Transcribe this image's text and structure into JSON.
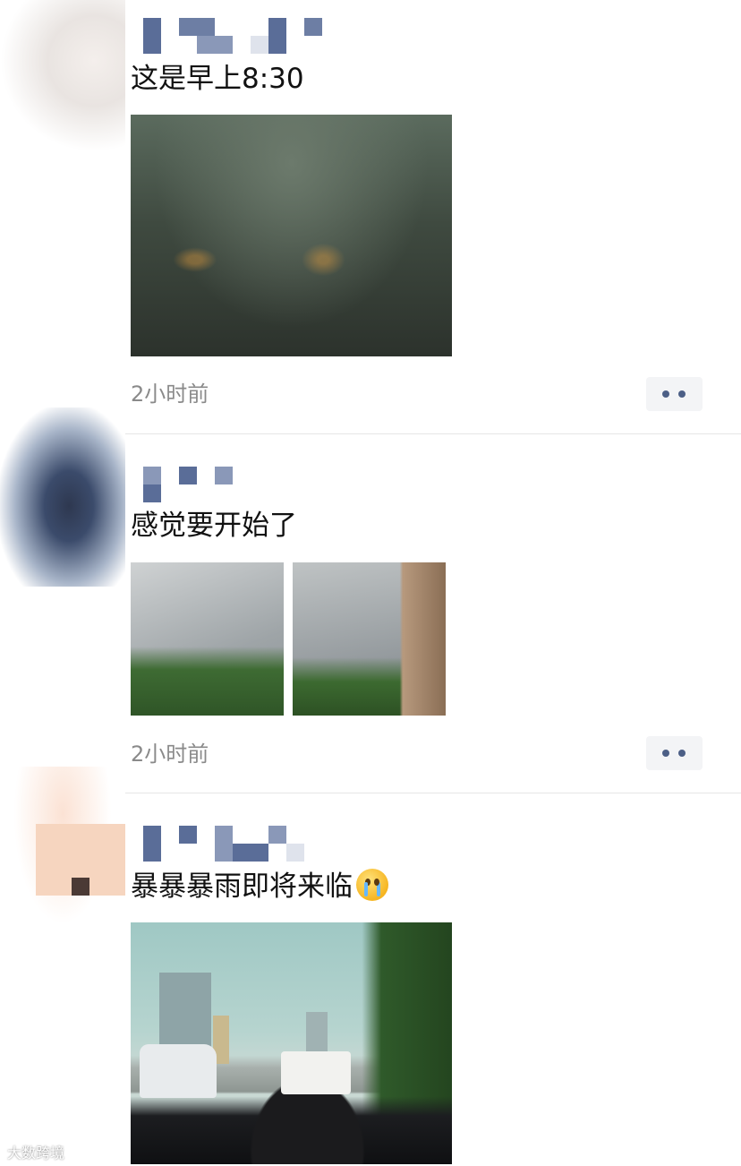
{
  "posts": [
    {
      "text": "这是早上8:30",
      "time": "2小时前",
      "photo_count": 1
    },
    {
      "text": "感觉要开始了",
      "time": "2小时前",
      "photo_count": 2
    },
    {
      "text": "暴暴暴雨即将来临",
      "emoji": "crying-face-emoji",
      "photo_count": 1
    }
  ],
  "watermark": "大数跨境",
  "colors": {
    "link_name": "#576b95",
    "time": "#8a8a8a",
    "text": "#111111"
  }
}
